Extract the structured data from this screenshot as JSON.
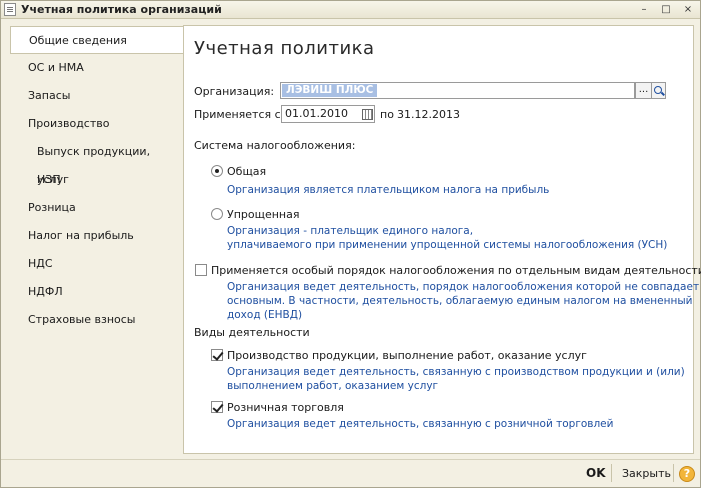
{
  "window": {
    "title": "Учетная политика организаций",
    "minimize_glyph": "–",
    "maximize_glyph": "□",
    "close_glyph": "×"
  },
  "nav": {
    "items": [
      {
        "label": "Общие сведения",
        "active": true
      },
      {
        "label": "ОС и НМА"
      },
      {
        "label": "Запасы"
      },
      {
        "label": "Производство"
      },
      {
        "label": "Выпуск продукции, услуг",
        "sub": true
      },
      {
        "label": "НЗП",
        "sub": true
      },
      {
        "label": "Розница"
      },
      {
        "label": "Налог на прибыль"
      },
      {
        "label": "НДС"
      },
      {
        "label": "НДФЛ"
      },
      {
        "label": "Страховые взносы"
      }
    ]
  },
  "main": {
    "title": "Учетная политика",
    "org_label": "Организация:",
    "org_value": "ЛЭВИШ ПЛЮС",
    "org_dots": "...",
    "applies_label": "Применяется с:",
    "applies_from": "01.01.2010",
    "applies_to_label": "по",
    "applies_to": "31.12.2013",
    "tax_system_label": "Система налогообложения:",
    "tax_general": {
      "label": "Общая",
      "selected": true,
      "desc": "Организация является плательщиком налога на прибыль"
    },
    "tax_simplified": {
      "label": "Упрощенная",
      "selected": false,
      "desc_line1": "Организация - плательщик единого налога,",
      "desc_line2": "уплачиваемого при применении упрощенной системы налогообложения (УСН)"
    },
    "special_order": {
      "label": "Применяется особый порядок налогообложения по отдельным видам деятельности",
      "checked": false,
      "desc_line1": "Организация ведет деятельность, порядок налогообложения которой не совпадает с",
      "desc_line2": "основным. В частности, деятельность, облагаемую единым налогом на вмененный",
      "desc_line3": "доход (ЕНВД)"
    },
    "activities_label": "Виды деятельности",
    "production": {
      "label": "Производство  продукции, выполнение работ, оказание услуг",
      "checked": true,
      "desc_line1": "Организация ведет деятельность, связанную с производством продукции и (или)",
      "desc_line2": "выполнением работ, оказанием услуг"
    },
    "retail": {
      "label": "Розничная торговля",
      "checked": true,
      "desc": "Организация ведет деятельность, связанную с розничной торговлей"
    }
  },
  "footer": {
    "ok_label": "OK",
    "close_label": "Закрыть",
    "help_label": "?"
  }
}
